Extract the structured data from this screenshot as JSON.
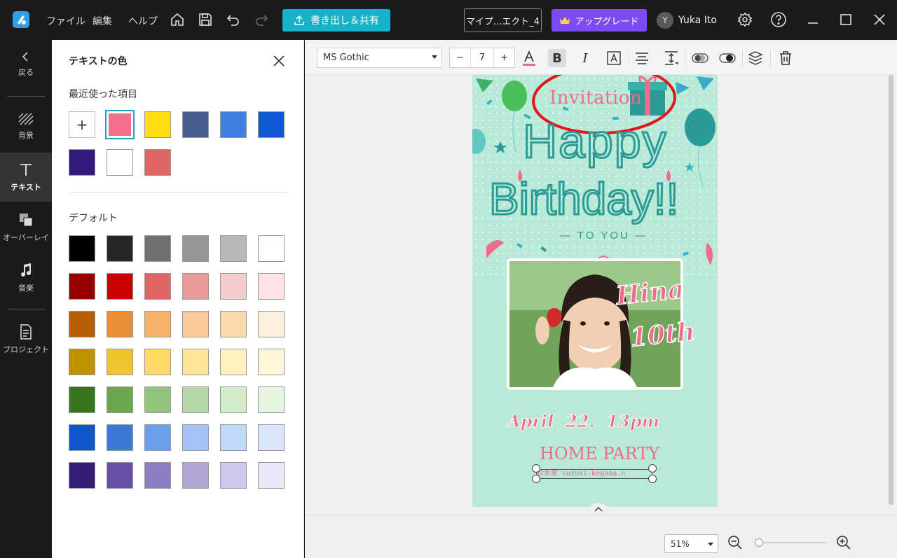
{
  "menu": {
    "file": "ファイル",
    "edit": "編集",
    "help": "ヘルプ"
  },
  "header": {
    "export_label": "書き出し＆共有",
    "project_name": "マイプ...エクト_4",
    "upgrade_label": "アップグレード",
    "user_initial": "Y",
    "user_name": "Yuka Ito"
  },
  "sidebar": {
    "items": [
      {
        "label": "戻る"
      },
      {
        "label": "背景"
      },
      {
        "label": "テキスト"
      },
      {
        "label": "オーバーレイ"
      },
      {
        "label": "音楽"
      },
      {
        "label": "プロジェクト"
      }
    ]
  },
  "panel": {
    "title": "テキストの色",
    "recent_label": "最近使った項目",
    "default_label": "デフォルト",
    "recent_colors": [
      "#f56f8a",
      "#ffdf13",
      "#4a5d8f",
      "#3f7fe0",
      "#0f57d4",
      "#341a7c",
      "#ffffff",
      "#e06666"
    ],
    "default_colors": [
      [
        "#000000",
        "#262626",
        "#707070",
        "#969696",
        "#b8b8b8",
        "#ffffff"
      ],
      [
        "#980000",
        "#cc0000",
        "#e06666",
        "#ea9999",
        "#f4cccc",
        "#ffe2e2"
      ],
      [
        "#b45f06",
        "#e69138",
        "#f6b26b",
        "#f9cb9c",
        "#fcd9ac",
        "#fdefdd"
      ],
      [
        "#bf9000",
        "#f1c232",
        "#ffd966",
        "#ffe599",
        "#fff0c0",
        "#fff6da"
      ],
      [
        "#38761d",
        "#6aa84f",
        "#93c47d",
        "#b6d7a8",
        "#d2ebcb",
        "#e6f5df"
      ],
      [
        "#1155cc",
        "#3c78d8",
        "#6d9eeb",
        "#a4c2f4",
        "#c0d8fc",
        "#d9e6fb"
      ],
      [
        "#351c75",
        "#674ea7",
        "#8e7cc3",
        "#b4a7d6",
        "#d0c8ea",
        "#ebe6f8"
      ]
    ]
  },
  "toolbar": {
    "font": "MS Gothic",
    "size": "7",
    "minus": "−",
    "plus": "+",
    "bold": "B",
    "italic": "I"
  },
  "card": {
    "invitation": "Invitation",
    "happy": "Happy",
    "birthday": "Birthday!!",
    "to_you": "— TO YOU —",
    "name": "Hina",
    "age": "10th",
    "date": "April  22.  13pm",
    "party": "HOME PARTY",
    "contact": "鈴木家  suzuki-ke@aaa.n"
  },
  "zoom": {
    "level": "51%",
    "slider_fraction": 0.05
  },
  "colors": {
    "accent": "#17b2c9",
    "upgrade": "#7d4cf0",
    "card_bg": "#b8ead7",
    "pink": "#ef6b8a",
    "teal": "#2a9b96"
  }
}
